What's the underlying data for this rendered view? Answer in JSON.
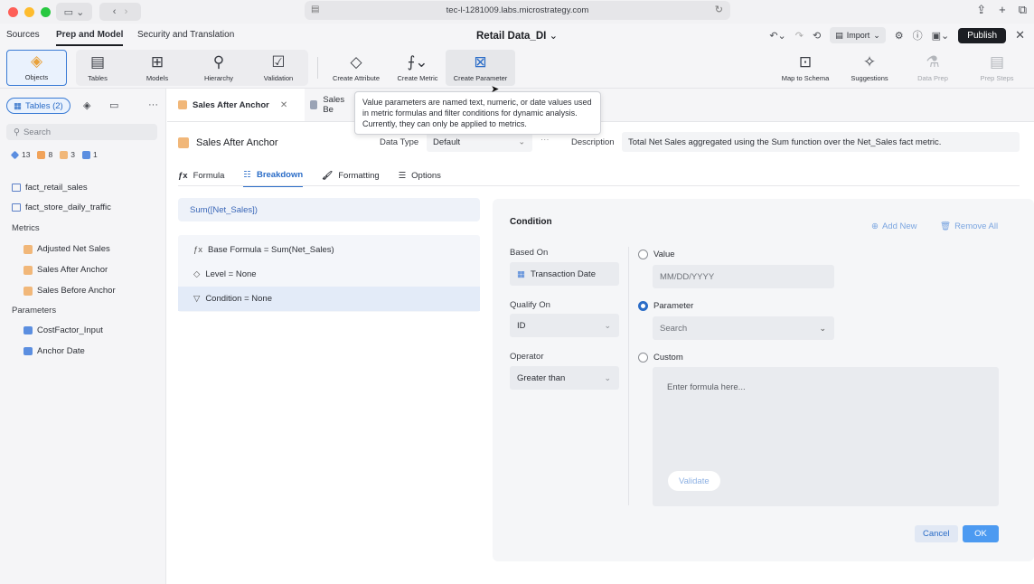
{
  "browser": {
    "url": "tec-l-1281009.labs.microstrategy.com"
  },
  "nav": {
    "tabs": [
      "Sources",
      "Prep and Model",
      "Security and Translation"
    ],
    "active_tab": "Prep and Model",
    "document_title": "Retail Data_DI",
    "import_label": "Import",
    "publish_label": "Publish"
  },
  "toolbar": {
    "objects": "Objects",
    "tables": "Tables",
    "models": "Models",
    "hierarchy": "Hierarchy",
    "validation": "Validation",
    "create_attribute": "Create Attribute",
    "create_metric": "Create Metric",
    "create_parameter": "Create Parameter",
    "map_to_schema": "Map to Schema",
    "suggestions": "Suggestions",
    "data_prep": "Data Prep",
    "prep_steps": "Prep Steps"
  },
  "tooltip": {
    "text": "Value parameters are named text, numeric, or date values used in metric formulas and filter conditions for dynamic analysis. Currently, they can only be applied to metrics."
  },
  "sidebar": {
    "tables_pill": "Tables (2)",
    "more": "···",
    "search_placeholder": "Search",
    "counts": [
      "13",
      "8",
      "3",
      "1"
    ],
    "tables": [
      "fact_retail_sales",
      "fact_store_daily_traffic"
    ],
    "metrics_header": "Metrics",
    "metrics": [
      "Adjusted Net Sales",
      "Sales After Anchor",
      "Sales Before Anchor"
    ],
    "parameters_header": "Parameters",
    "parameters": [
      "CostFactor_Input",
      "Anchor Date"
    ]
  },
  "editor_tabs": {
    "active": "Sales After Anchor",
    "second": "Sales Be"
  },
  "metric": {
    "name": "Sales After Anchor",
    "data_type_label": "Data Type",
    "data_type_value": "Default",
    "description_label": "Description",
    "description_value": "Total Net Sales aggregated using the Sum function over the Net_Sales fact metric."
  },
  "subtabs": [
    "Formula",
    "Breakdown",
    "Formatting",
    "Options"
  ],
  "breakdown": {
    "formula": "Sum([Net_Sales])",
    "rows": [
      "Base Formula = Sum(Net_Sales)",
      "Level = None",
      "Condition = None"
    ]
  },
  "condition": {
    "title": "Condition",
    "add_new": "Add New",
    "remove_all": "Remove All",
    "based_on_label": "Based On",
    "based_on_value": "Transaction Date",
    "qualify_on_label": "Qualify On",
    "qualify_on_value": "ID",
    "operator_label": "Operator",
    "operator_value": "Greater than",
    "value_label": "Value",
    "value_placeholder": "MM/DD/YYYY",
    "parameter_label": "Parameter",
    "parameter_placeholder": "Search",
    "custom_label": "Custom",
    "custom_placeholder": "Enter formula here...",
    "validate_label": "Validate",
    "cancel_label": "Cancel",
    "ok_label": "OK"
  },
  "colors": {
    "accent": "#2a6cc7",
    "ok_button": "#4c9af1",
    "publish_button": "#1c1e23"
  }
}
